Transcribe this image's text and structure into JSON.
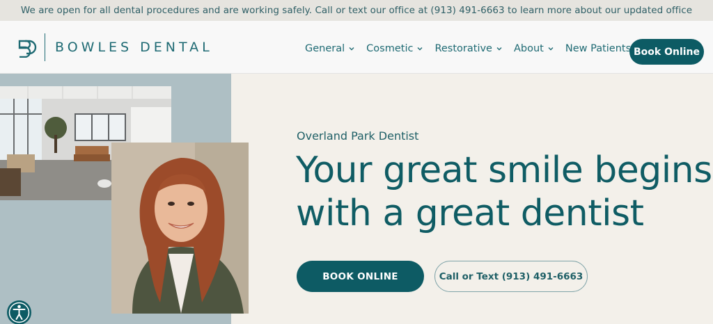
{
  "announcement": "We are open for all dental procedures and are working safely. Call or text our office at (913) 491-6663 to learn more about our updated office protocols.",
  "brand": {
    "name": "BOWLES DENTAL",
    "accent_color": "#0d5b64",
    "mark_icon": "bd-monogram-icon"
  },
  "nav": {
    "items": [
      {
        "label": "General"
      },
      {
        "label": "Cosmetic"
      },
      {
        "label": "Restorative"
      },
      {
        "label": "About"
      },
      {
        "label": "New Patients"
      }
    ],
    "book_label": "Book Online"
  },
  "hero": {
    "kicker": "Overland Park Dentist",
    "title_line1": "Your great smile begins",
    "title_line2": "with a great dentist",
    "book_label": "BOOK ONLINE",
    "call_label": "Call or Text (913) 491-6663"
  },
  "accessibility_icon": "accessibility-icon"
}
